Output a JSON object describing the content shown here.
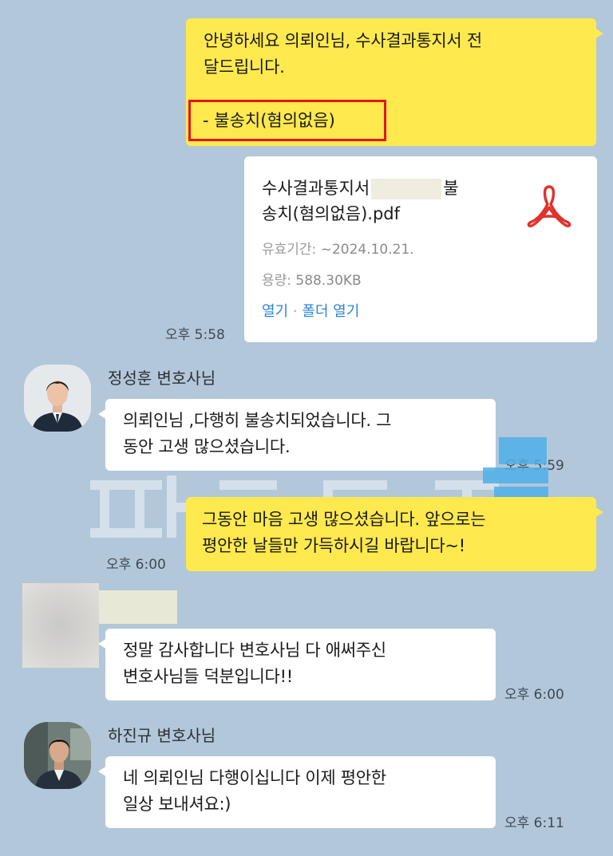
{
  "messages": {
    "m1": {
      "line1": "안녕하세요 의뢰인님, 수사결과통지서 전",
      "line2": "달드립니다.",
      "highlight": "- 불송치(혐의없음)"
    },
    "file": {
      "name_line1_prefix": "수사결과통지서",
      "name_line1_suffix": "불",
      "name_line2": "송치(혐의없음).pdf",
      "validity_label": "유효기간:",
      "validity_value": "~2024.10.21.",
      "size_label": "용량:",
      "size_value": "588.30KB",
      "open_link": "열기",
      "separator": "·",
      "folder_link": "폴더 열기",
      "icon": "acrobat-pdf-icon",
      "time": "오후 5:58"
    },
    "m2": {
      "sender": "정성훈 변호사님",
      "line1": "의뢰인님 ,다행히 불송치되었습니다. 그",
      "line2": "동안 고생 많으셨습니다.",
      "time": "오후 5:59"
    },
    "m3": {
      "line1": "그동안 마음 고생 많으셨습니다. 앞으로는",
      "line2": "평안한 날들만 가득하시길 바랍니다~!",
      "time": "오후 6:00"
    },
    "m4": {
      "line1": "정말 감사합니다 변호사님 다 애써주신",
      "line2": "변호사님들 덕분입니다!!",
      "time": "오후 6:00"
    },
    "m5": {
      "sender": "하진규 변호사님",
      "line1": "네 의뢰인님 다행이십니다 이제 평안한",
      "line2": "일상 보내셔요:)",
      "time": "오후 6:11"
    }
  },
  "colors": {
    "background": "#b2c7da",
    "my_bubble": "#fee94e",
    "other_bubble": "#ffffff",
    "highlight_border": "#e8121c",
    "link": "#2b84d8",
    "pdf_icon": "#e0312a"
  }
}
